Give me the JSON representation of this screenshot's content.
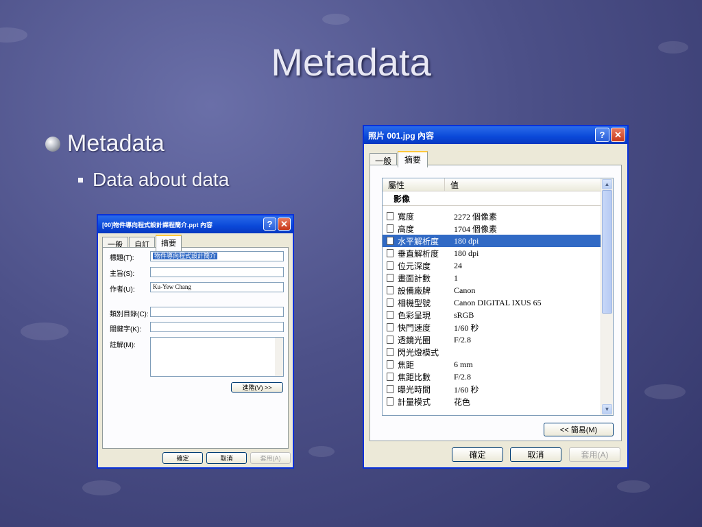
{
  "slide": {
    "title": "Metadata",
    "bullet1": "Metadata",
    "bullet2": "Data about data"
  },
  "small_dialog": {
    "title": "[00]物件導向程式設計課程簡介.ppt 內容",
    "tabs": [
      "一般",
      "自訂",
      "摘要"
    ],
    "active_tab": "摘要",
    "fields": {
      "title_label": "標題(T):",
      "title_value": "物件導向程式設計簡介",
      "subject_label": "主旨(S):",
      "subject_value": "",
      "author_label": "作者(U):",
      "author_value": "Ku-Yew Chang",
      "category_label": "類別目錄(C):",
      "category_value": "",
      "keywords_label": "關鍵字(K):",
      "keywords_value": "",
      "comments_label": "註解(M):",
      "comments_value": ""
    },
    "advanced_button": "進階(V) >>",
    "ok_button": "確定",
    "cancel_button": "取消",
    "apply_button": "套用(A)"
  },
  "large_dialog": {
    "title": "照片 001.jpg 內容",
    "tabs": [
      "一般",
      "摘要"
    ],
    "active_tab": "摘要",
    "columns": {
      "property": "屬性",
      "value": "值"
    },
    "group": "影像",
    "rows": [
      {
        "name": "寬度",
        "value": "2272 個像素"
      },
      {
        "name": "高度",
        "value": "1704 個像素"
      },
      {
        "name": "水平解析度",
        "value": "180 dpi"
      },
      {
        "name": "垂直解析度",
        "value": "180 dpi"
      },
      {
        "name": "位元深度",
        "value": "24"
      },
      {
        "name": "畫面計數",
        "value": "1"
      },
      {
        "name": "設備廠牌",
        "value": "Canon"
      },
      {
        "name": "相機型號",
        "value": "Canon DIGITAL IXUS 65"
      },
      {
        "name": "色彩呈現",
        "value": "sRGB"
      },
      {
        "name": "快門速度",
        "value": "1/60 秒"
      },
      {
        "name": "透鏡光圈",
        "value": "F/2.8"
      },
      {
        "name": "閃光燈模式",
        "value": ""
      },
      {
        "name": "焦距",
        "value": "6 mm"
      },
      {
        "name": "焦距比數",
        "value": "F/2.8"
      },
      {
        "name": "曝光時間",
        "value": "1/60 秒"
      },
      {
        "name": "計量模式",
        "value": "花色"
      }
    ],
    "selected_row": "水平解析度",
    "simple_button": "<< 簡易(M)",
    "ok_button": "確定",
    "cancel_button": "取消",
    "apply_button": "套用(A)"
  },
  "colors": {
    "xp_title_blue": "#0a48d8",
    "selection_blue": "#316ac5",
    "dialog_face": "#ece9d8",
    "close_red": "#c8391b"
  }
}
